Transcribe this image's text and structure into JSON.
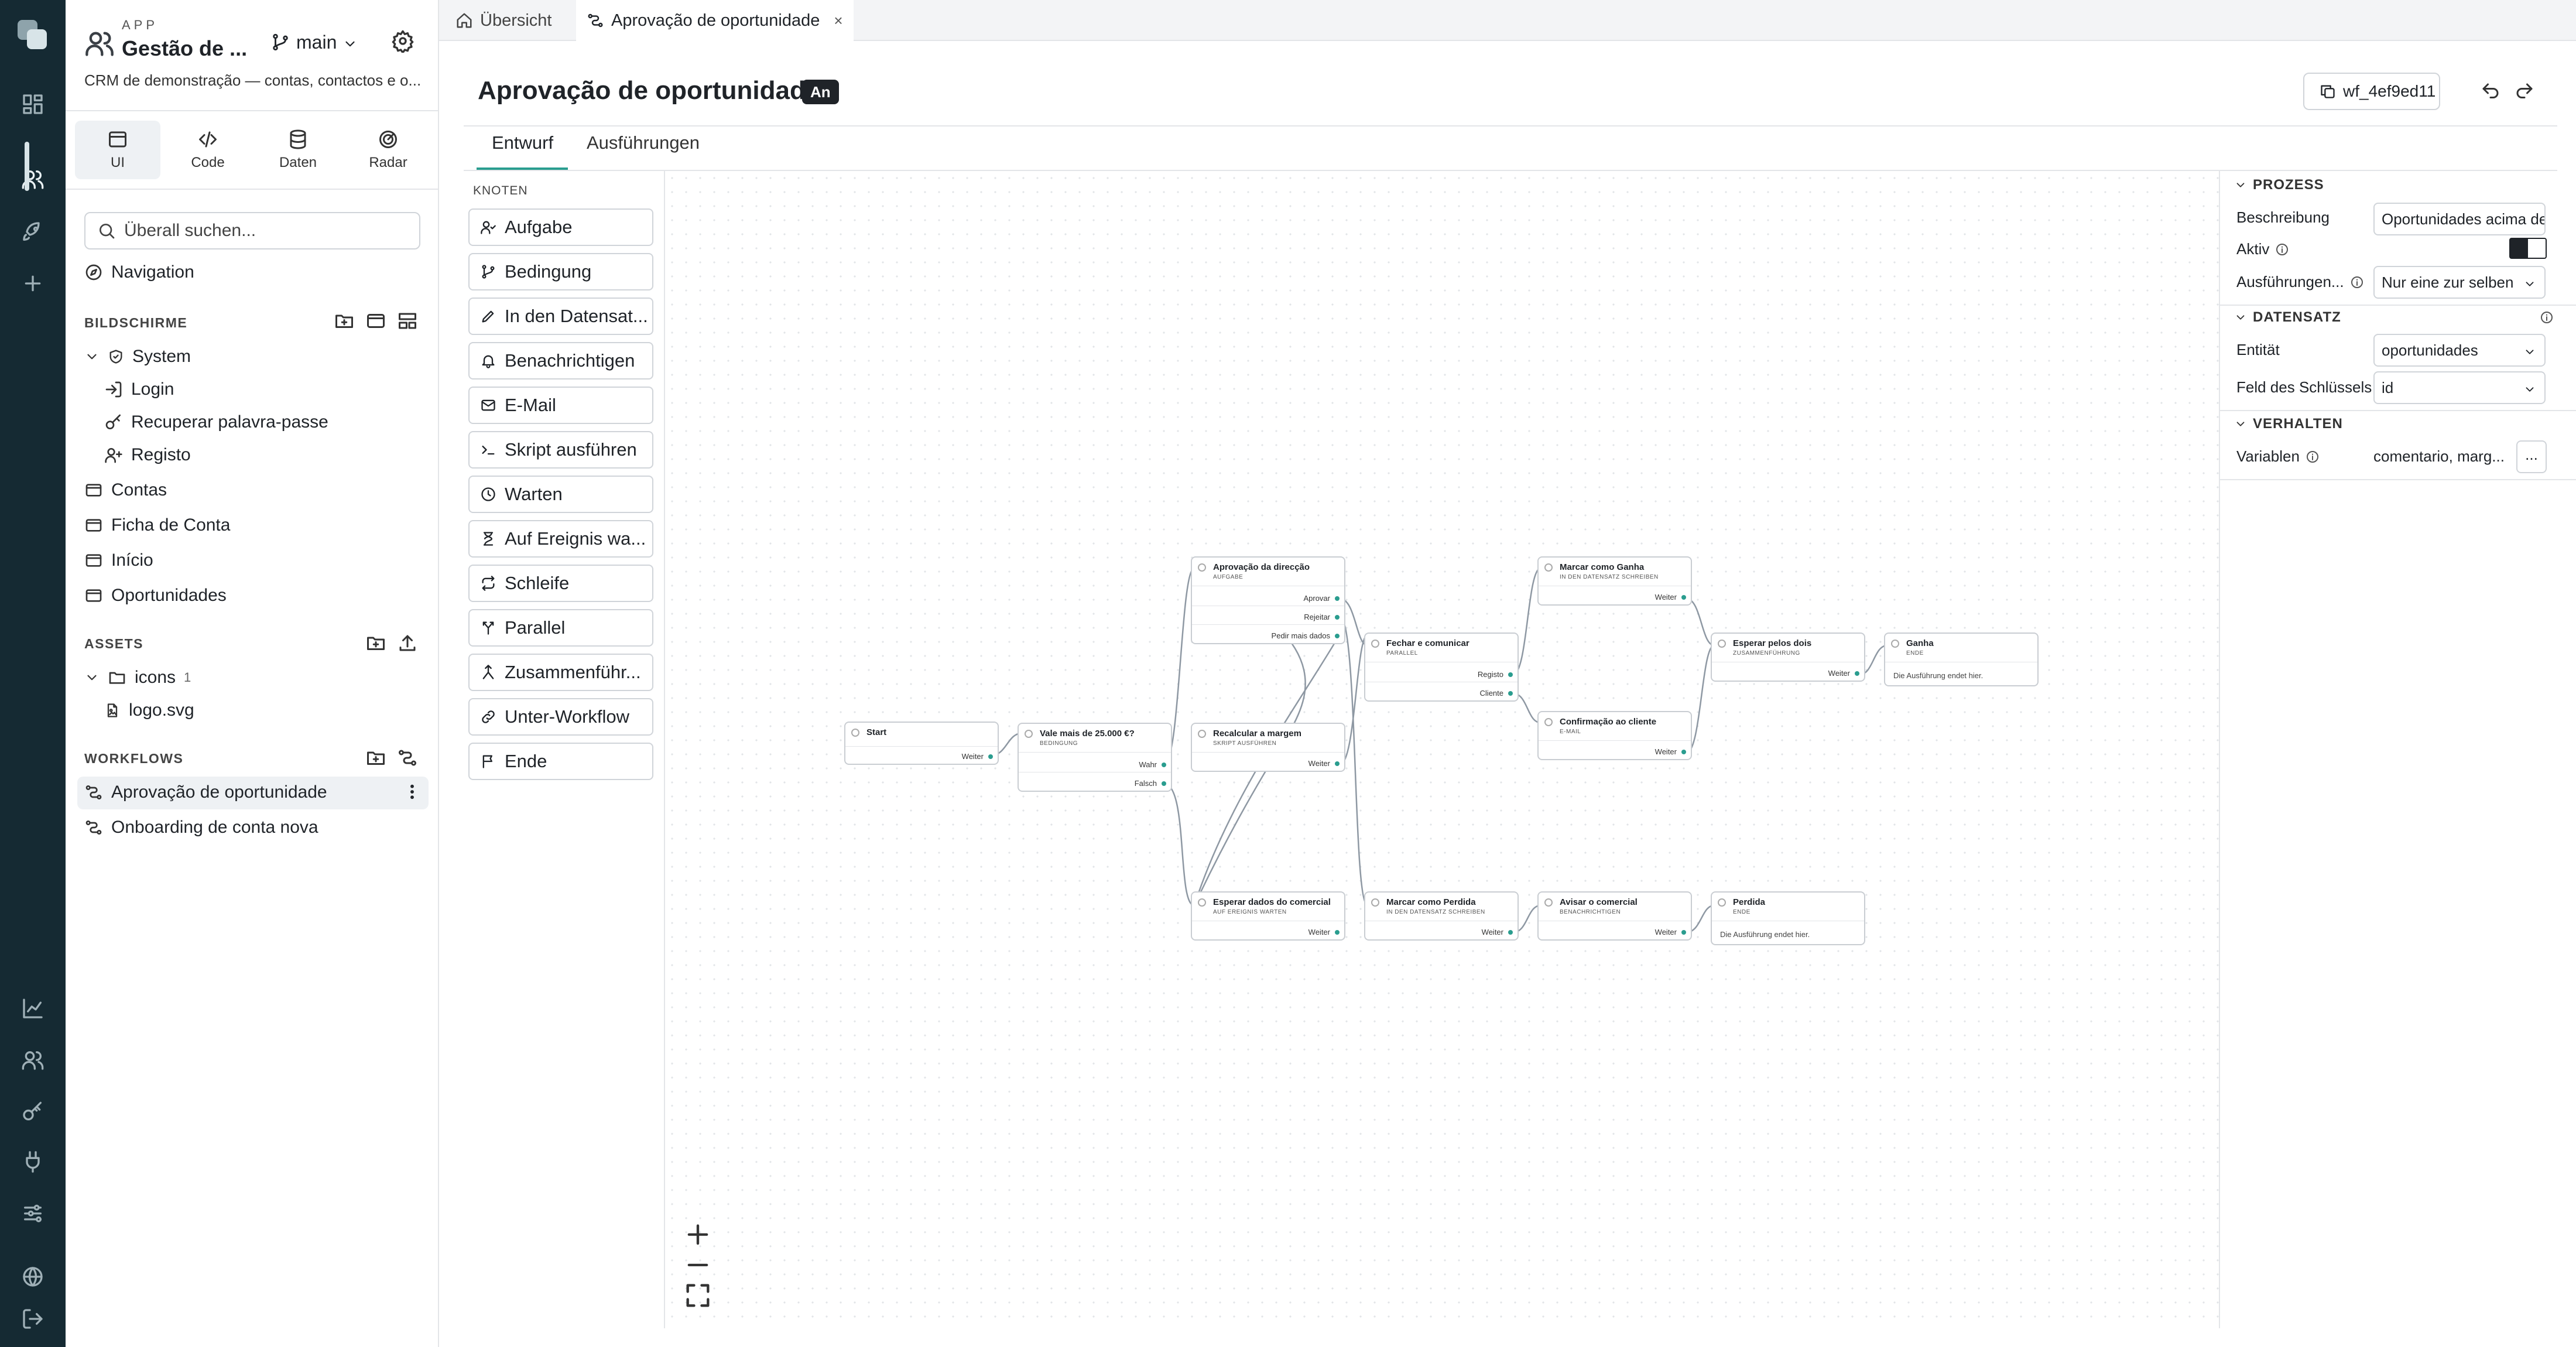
{
  "app": {
    "label": "APP",
    "name": "Gestão de ...",
    "branch": "main",
    "description": "CRM de demonstração — contas, contactos e o..."
  },
  "modes": [
    {
      "label": "UI"
    },
    {
      "label": "Code"
    },
    {
      "label": "Daten"
    },
    {
      "label": "Radar"
    }
  ],
  "search": {
    "placeholder": "Überall suchen..."
  },
  "navigation": "Navigation",
  "screens": {
    "title": "BILDSCHIRME",
    "group": "System",
    "group_items": [
      "Login",
      "Recuperar palavra-passe",
      "Registo"
    ],
    "items": [
      "Contas",
      "Ficha de Conta",
      "Início",
      "Oportunidades"
    ]
  },
  "assets": {
    "title": "ASSETS",
    "folder": "icons",
    "folder_count": "1",
    "file": "logo.svg"
  },
  "workflows": {
    "title": "WORKFLOWS",
    "items": [
      "Aprovação de oportunidade",
      "Onboarding de conta nova"
    ]
  },
  "tabs": [
    {
      "label": "Übersicht"
    },
    {
      "label": "Aprovação de oportunidade",
      "close": "×"
    }
  ],
  "header": {
    "title": "Aprovação de oportunidade",
    "badge": "An",
    "workflow_id": "wf_4ef9ed11"
  },
  "view_tabs": [
    "Entwurf",
    "Ausführungen"
  ],
  "palette": {
    "title": "KNOTEN",
    "items": [
      "Aufgabe",
      "Bedingung",
      "In den Datensat...",
      "Benachrichtigen",
      "E-Mail",
      "Skript ausführen",
      "Warten",
      "Auf Ereignis wa...",
      "Schleife",
      "Parallel",
      "Zusammenführ...",
      "Unter-Workflow",
      "Ende"
    ]
  },
  "nodes": {
    "start": {
      "title": "Start",
      "outputs": [
        "Weiter"
      ]
    },
    "cond": {
      "title": "Vale mais de 25.000 €?",
      "type": "BEDINGUNG",
      "outputs": [
        "Wahr",
        "Falsch"
      ]
    },
    "approve": {
      "title": "Aprovação da direcção",
      "type": "AUFGABE",
      "outputs": [
        "Aprovar",
        "Rejeitar",
        "Pedir mais dados"
      ]
    },
    "recalc": {
      "title": "Recalcular a margem",
      "type": "SKRIPT AUSFÜHREN",
      "outputs": [
        "Weiter"
      ]
    },
    "waitdata": {
      "title": "Esperar dados do comercial",
      "type": "AUF EREIGNIS WARTEN",
      "outputs": [
        "Weiter"
      ]
    },
    "close": {
      "title": "Fechar e comunicar",
      "type": "PARALLEL",
      "outputs": [
        "Registo",
        "Cliente"
      ]
    },
    "lost": {
      "title": "Marcar como Perdida",
      "type": "IN DEN DATENSATZ SCHREIBEN",
      "outputs": [
        "Weiter"
      ]
    },
    "won": {
      "title": "Marcar como Ganha",
      "type": "IN DEN DATENSATZ SCHREIBEN",
      "outputs": [
        "Weiter"
      ]
    },
    "confirm": {
      "title": "Confirmação ao cliente",
      "type": "E-MAIL",
      "outputs": [
        "Weiter"
      ]
    },
    "notify": {
      "title": "Avisar o comercial",
      "type": "BENACHRICHTIGEN",
      "outputs": [
        "Weiter"
      ]
    },
    "waitboth": {
      "title": "Esperar pelos dois",
      "type": "ZUSAMMENFÜHRUNG",
      "outputs": [
        "Weiter"
      ]
    },
    "ganha": {
      "title": "Ganha",
      "type": "ENDE",
      "note": "Die Ausführung endet hier."
    },
    "perdida": {
      "title": "Perdida",
      "type": "ENDE",
      "note": "Die Ausführung endet hier."
    }
  },
  "properties": {
    "process": {
      "title": "PROZESS",
      "description_label": "Beschreibung",
      "description_value": "Oportunidades acima de",
      "active_label": "Aktiv",
      "runs_label": "Ausführungen...",
      "runs_value": "Nur eine zur selben"
    },
    "dataset": {
      "title": "DATENSATZ",
      "entity_label": "Entität",
      "entity_value": "oportunidades",
      "key_label": "Feld des Schlüssels",
      "key_value": "id"
    },
    "behavior": {
      "title": "VERHALTEN",
      "variables_label": "Variablen",
      "variables_value": "comentario, marg...",
      "more": "..."
    }
  },
  "colors": {
    "rail": "#152a33",
    "accent_dot": "#2a9d8f",
    "badge": "#1f2328"
  }
}
